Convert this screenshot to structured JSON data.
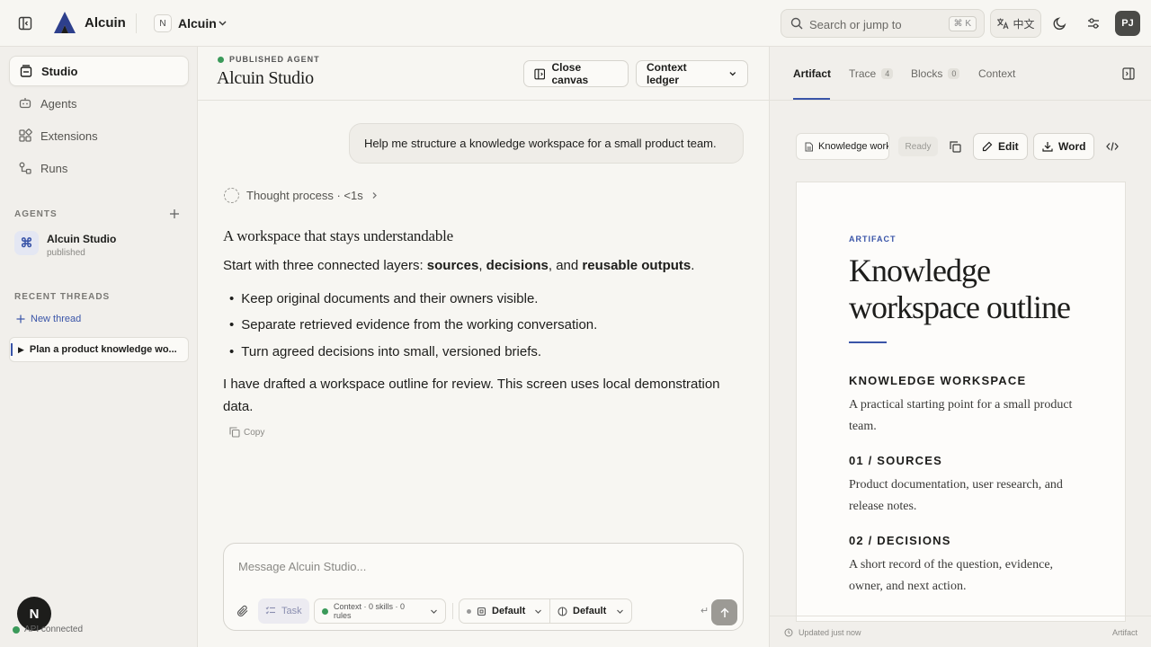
{
  "app": {
    "name": "Alcuin",
    "workspace_initial": "N",
    "workspace_name": "Alcuin"
  },
  "topbar": {
    "search_placeholder": "Search or jump to",
    "search_shortcut": "⌘ K",
    "language": "中文",
    "user_initials": "PJ"
  },
  "sidebar": {
    "nav": [
      {
        "label": "Studio",
        "icon": "studio-icon",
        "active": true
      },
      {
        "label": "Agents",
        "icon": "agents-icon"
      },
      {
        "label": "Extensions",
        "icon": "extensions-icon"
      },
      {
        "label": "Runs",
        "icon": "runs-icon"
      }
    ],
    "agents_label": "AGENTS",
    "agent": {
      "name": "Alcuin Studio",
      "status": "published",
      "glyph": "⌘"
    },
    "recent_label": "RECENT THREADS",
    "new_thread": "New thread",
    "thread": "Plan a product knowledge wo...",
    "account_initial": "N",
    "api_status": "API connected"
  },
  "chat": {
    "kicker": "PUBLISHED AGENT",
    "title": "Alcuin Studio",
    "close_canvas": "Close canvas",
    "context_ledger": "Context ledger",
    "user_message": "Help me structure a knowledge workspace for a small product team.",
    "thought": "Thought process · <1s",
    "answer_title": "A workspace that stays understandable",
    "answer_intro_prefix": "Start with three connected layers: ",
    "answer_intro_b1": "sources",
    "answer_intro_sep1": ", ",
    "answer_intro_b2": "decisions",
    "answer_intro_sep2": ", and ",
    "answer_intro_b3": "reusable outputs",
    "answer_intro_end": ".",
    "bullets": [
      "Keep original documents and their owners visible.",
      "Separate retrieved evidence from the working conversation.",
      "Turn agreed decisions into small, versioned briefs."
    ],
    "answer_outro": "I have drafted a workspace outline for review. This screen uses local demonstration data.",
    "copy": "Copy"
  },
  "composer": {
    "placeholder": "Message Alcuin Studio...",
    "task": "Task",
    "context": "Context · 0 skills · 0 rules",
    "model1": "Default",
    "model2": "Default",
    "enter_hint": "↵"
  },
  "panel": {
    "tabs": [
      {
        "label": "Artifact"
      },
      {
        "label": "Trace",
        "count": "4"
      },
      {
        "label": "Blocks",
        "count": "0"
      },
      {
        "label": "Context"
      }
    ],
    "doc_tab": "Knowledge workspace outline",
    "status": "Ready",
    "edit": "Edit",
    "word": "Word",
    "doc": {
      "kicker": "ARTIFACT",
      "title": "Knowledge workspace outline",
      "h1": "KNOWLEDGE WORKSPACE",
      "p1": "A practical starting point for a small product team.",
      "h2": "01 / SOURCES",
      "p2": "Product documentation, user research, and release notes.",
      "h3": "02 / DECISIONS",
      "p3": "A short record of the question, evidence, owner, and next action."
    },
    "footer_left": "Updated just now",
    "footer_right": "Artifact"
  },
  "colors": {
    "accent": "#3a55a8",
    "status_green": "#3b9a5a",
    "background": "#f7f6f2"
  }
}
